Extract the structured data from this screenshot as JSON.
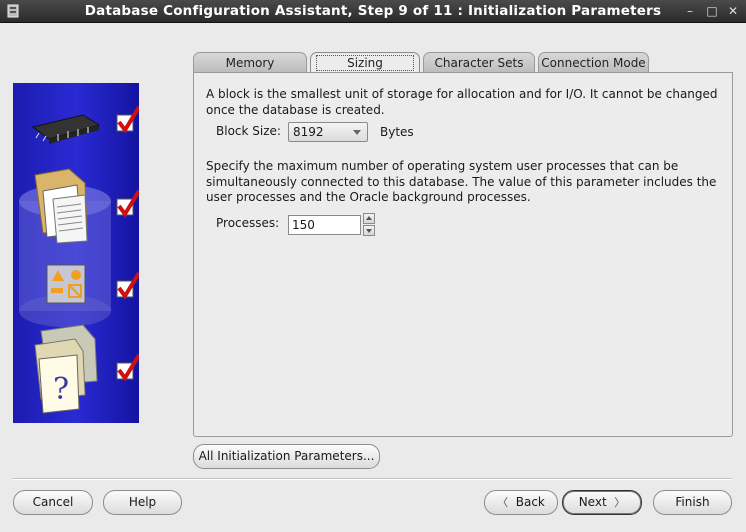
{
  "window": {
    "title": "Database Configuration Assistant, Step 9 of 11 : Initialization Parameters",
    "minimize": "–",
    "maximize": "□",
    "close": "✕"
  },
  "tabs": [
    {
      "label": "Memory",
      "active": false
    },
    {
      "label": "Sizing",
      "active": true
    },
    {
      "label": "Character Sets",
      "active": false
    },
    {
      "label": "Connection Mode",
      "active": false
    }
  ],
  "sizing": {
    "block_description": "A block is the smallest unit of storage for allocation and for I/O. It cannot be changed once the database is created.",
    "block_size_label": "Block Size:",
    "block_size_value": "8192",
    "block_size_unit": "Bytes",
    "processes_description": "Specify the maximum number of operating system user processes that can be simultaneously connected to this database. The value of this parameter includes the user processes and the Oracle background processes.",
    "processes_label": "Processes:",
    "processes_value": "150"
  },
  "buttons": {
    "all_params": "All Initialization Parameters...",
    "cancel": "Cancel",
    "help": "Help",
    "back": "Back",
    "next": "Next",
    "finish": "Finish"
  },
  "colors": {
    "illustration_bg": "#2020c0",
    "check_red": "#cc1111"
  },
  "icons": [
    "app-icon",
    "memory-chip-icon",
    "documents-icon",
    "shapes-icon",
    "help-document-icon",
    "checkmark-icon"
  ]
}
